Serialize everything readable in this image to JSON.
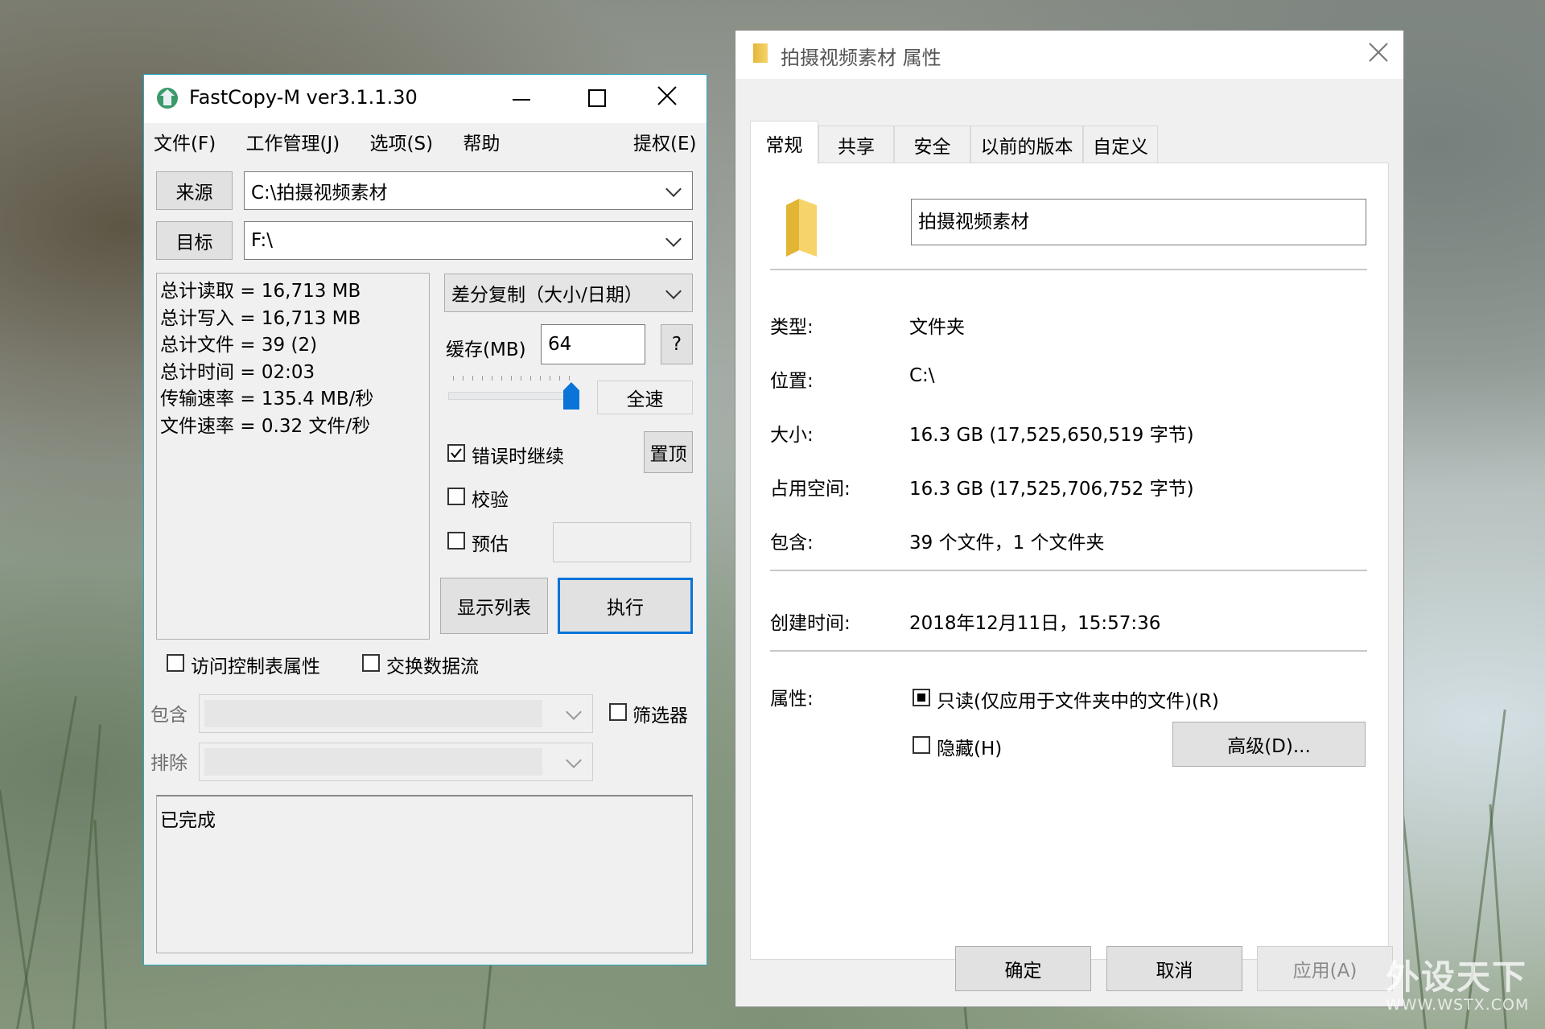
{
  "fastcopy": {
    "title": "FastCopy-M ver3.1.1.30",
    "menu": [
      "文件(F)",
      "工作管理(J)",
      "选项(S)",
      "帮助"
    ],
    "menu_right": "提权(E)",
    "source_btn": "来源",
    "source_value": "C:\\拍摄视频素材",
    "target_btn": "目标",
    "target_value": "F:\\",
    "stats": [
      "总计读取 = 16,713 MB",
      "总计写入 = 16,713 MB",
      "总计文件 = 39 (2)",
      "总计时间 = 02:03",
      "传输速率 = 135.4 MB/秒",
      "文件速率 = 0.32 文件/秒"
    ],
    "mode_value": "差分复制（大小/日期）",
    "buffer_label": "缓存(MB)",
    "buffer_value": "64",
    "help_btn": "?",
    "fullspeed_btn": "全速",
    "continue_on_error": "错误时继续",
    "continue_on_error_checked": true,
    "top_btn": "置顶",
    "verify": "校验",
    "verify_checked": false,
    "estimate": "预估",
    "estimate_checked": false,
    "list_btn": "显示列表",
    "execute_btn": "执行",
    "acl": "访问控制表属性",
    "acl_checked": false,
    "altstream": "交换数据流",
    "altstream_checked": false,
    "include_label": "包含",
    "exclude_label": "排除",
    "filter": "筛选器",
    "filter_checked": false,
    "log": "已完成"
  },
  "props": {
    "title": "拍摄视频素材 属性",
    "tabs": [
      "常规",
      "共享",
      "安全",
      "以前的版本",
      "自定义"
    ],
    "active_tab": 0,
    "folder_name": "拍摄视频素材",
    "rows": [
      {
        "label": "类型:",
        "value": "文件夹"
      },
      {
        "label": "位置:",
        "value": "C:\\"
      },
      {
        "label": "大小:",
        "value": "16.3 GB (17,525,650,519 字节)"
      },
      {
        "label": "占用空间:",
        "value": "16.3 GB (17,525,706,752 字节)"
      },
      {
        "label": "包含:",
        "value": "39 个文件，1 个文件夹"
      }
    ],
    "created_label": "创建时间:",
    "created_value": "2018年12月11日，15:57:36",
    "attr_label": "属性:",
    "readonly": "只读(仅应用于文件夹中的文件)(R)",
    "hidden": "隐藏(H)",
    "advanced_btn": "高级(D)...",
    "ok_btn": "确定",
    "cancel_btn": "取消",
    "apply_btn": "应用(A)"
  },
  "watermark": {
    "main": "外设天下",
    "url": "WWW.WSTX.COM"
  }
}
